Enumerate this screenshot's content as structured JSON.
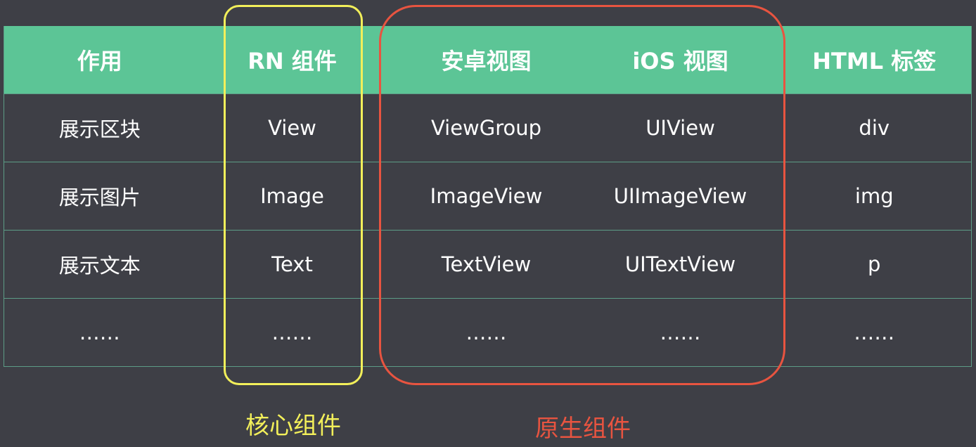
{
  "table": {
    "headers": [
      "作用",
      "RN 组件",
      "安卓视图",
      "iOS 视图",
      "HTML 标签"
    ],
    "rows": [
      [
        "展示区块",
        "View",
        "ViewGroup",
        "UIView",
        "div"
      ],
      [
        "展示图片",
        "Image",
        "ImageView",
        "UIImageView",
        "img"
      ],
      [
        "展示文本",
        "Text",
        "TextView",
        "UITextView",
        "p"
      ],
      [
        "……",
        "……",
        "……",
        "……",
        "……"
      ]
    ]
  },
  "captions": {
    "core": "核心组件",
    "native": "原生组件"
  },
  "colors": {
    "background": "#3e3f46",
    "header": "#5cc596",
    "core_highlight": "#f2ef5a",
    "native_highlight": "#e85440"
  }
}
